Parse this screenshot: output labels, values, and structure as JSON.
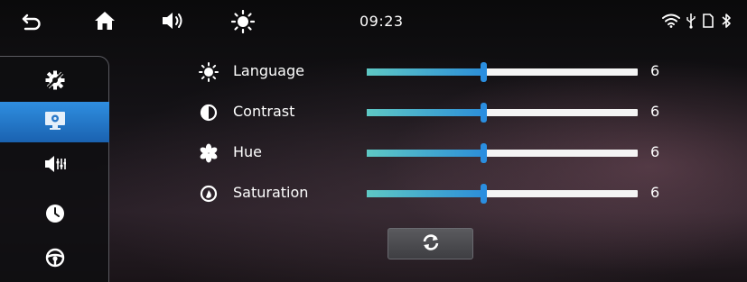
{
  "status_bar": {
    "time": "09:23",
    "icons": [
      "back-icon",
      "home-icon",
      "volume-icon",
      "brightness-icon",
      "wifi-icon",
      "usb-icon",
      "sd-card-icon",
      "bluetooth-icon"
    ]
  },
  "sidebar": {
    "items": [
      {
        "name": "general-settings-icon"
      },
      {
        "name": "display-settings-icon",
        "active": true
      },
      {
        "name": "sound-settings-icon"
      },
      {
        "name": "clock-settings-icon"
      },
      {
        "name": "steering-wheel-icon"
      }
    ]
  },
  "settings": [
    {
      "label": "Language",
      "value": "6",
      "level": 6,
      "max": 14,
      "icon": "brightness-icon"
    },
    {
      "label": "Contrast",
      "value": "6",
      "level": 6,
      "max": 14,
      "icon": "contrast-icon"
    },
    {
      "label": "Hue",
      "value": "6",
      "level": 6,
      "max": 14,
      "icon": "hue-icon"
    },
    {
      "label": "Saturation",
      "value": "6",
      "level": 6,
      "max": 14,
      "icon": "saturation-icon"
    }
  ],
  "reset_icon": "reset-icon",
  "colors": {
    "accent": "#2a8ee0",
    "fill_start": "#5ec8c4",
    "track": "#f4f4f4"
  }
}
